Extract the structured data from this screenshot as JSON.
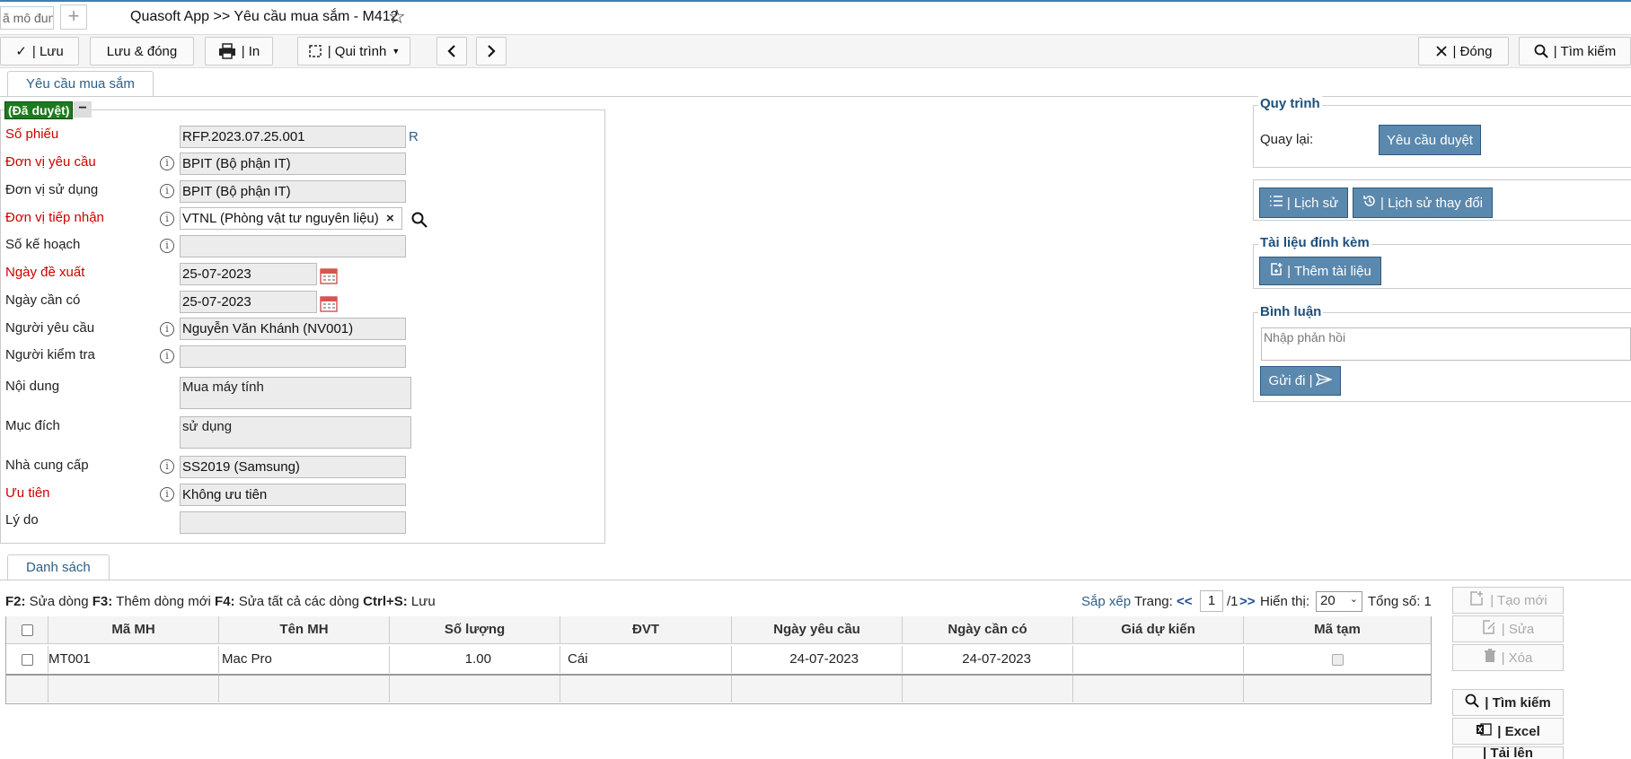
{
  "top": {
    "module_search": "ã mô đun",
    "title": "Quasoft App >> Yêu cầu mua sắm - M412"
  },
  "toolbar": {
    "save": "| Lưu",
    "save_close": "Lưu & đóng",
    "print": "| In",
    "workflow": "| Qui trình",
    "close": "| Đóng",
    "search": "| Tìm kiếm"
  },
  "tabs": {
    "form_tab": "Yêu cầu mua sắm",
    "list_tab": "Danh sách"
  },
  "form": {
    "status": "(Đã duyệt)",
    "collapse": "−",
    "fields": {
      "so_phieu": {
        "label": "Số phiếu",
        "value": "RFP.2023.07.25.001",
        "suffix": "R"
      },
      "don_vi_yeu_cau": {
        "label": "Đơn vị yêu cầu",
        "value": "BPIT (Bộ phận IT)"
      },
      "don_vi_su_dung": {
        "label": "Đơn vị sử dụng",
        "value": "BPIT (Bộ phận IT)"
      },
      "don_vi_tiep_nhan": {
        "label": "Đơn vị tiếp nhận",
        "value": "VTNL (Phòng vật tư nguyên liệu)"
      },
      "so_ke_hoach": {
        "label": "Số kế hoạch",
        "value": ""
      },
      "ngay_de_xuat": {
        "label": "Ngày đề xuất",
        "value": "25-07-2023"
      },
      "ngay_can_co": {
        "label": "Ngày cần có",
        "value": "25-07-2023"
      },
      "nguoi_yeu_cau": {
        "label": "Người yêu cầu",
        "value": "Nguyễn Văn Khánh (NV001)"
      },
      "nguoi_kiem_tra": {
        "label": "Người kiểm tra",
        "value": ""
      },
      "noi_dung": {
        "label": "Nội dung",
        "value": "Mua máy tính"
      },
      "muc_dich": {
        "label": "Mục đích",
        "value": "sử dụng"
      },
      "nha_cung_cap": {
        "label": "Nhà cung cấp",
        "value": "SS2019 (Samsung)"
      },
      "uu_tien": {
        "label": "Ưu tiên",
        "value": "Không ưu tiên"
      },
      "ly_do": {
        "label": "Lý do",
        "value": ""
      }
    }
  },
  "right": {
    "workflow_title": "Quy trình",
    "back_label": "Quay lại:",
    "request_approval": "Yêu cầu duyệt",
    "history": "| Lịch sử",
    "change_history": "| Lịch sử thay đổi",
    "attachments_title": "Tài liệu đính kèm",
    "add_document": "| Thêm tài liệu",
    "comment_title": "Bình luận",
    "comment_placeholder": "Nhập phản hồi",
    "send": "Gửi đi |"
  },
  "list": {
    "hint_f2": "F2:",
    "hint_f2_text": " Sửa dòng ",
    "hint_f3": "F3:",
    "hint_f3_text": " Thêm dòng mới ",
    "hint_f4": "F4:",
    "hint_f4_text": " Sửa tất cả các dòng ",
    "hint_ctrl": "Ctrl+S:",
    "hint_ctrl_text": " Lưu",
    "sort": "Sắp xếp",
    "page_label": "Trang:",
    "first": "<<",
    "page": "1",
    "page_total": "/1",
    "next": ">>",
    "show_label": "Hiển thị:",
    "page_size": "20",
    "total_label": "Tổng số: 1",
    "columns": [
      "Mã MH",
      "Tên MH",
      "Số lượng",
      "ĐVT",
      "Ngày yêu cầu",
      "Ngày cần có",
      "Giá dự kiến",
      "Mã tạm"
    ],
    "rows": [
      {
        "ma_mh": "MT001",
        "ten_mh": "Mac Pro",
        "so_luong": "1.00",
        "dvt": "Cái",
        "ngay_yeu_cau": "24-07-2023",
        "ngay_can_co": "24-07-2023",
        "gia_du_kien": ""
      }
    ],
    "side": {
      "new": "| Tạo mới",
      "edit": "| Sửa",
      "delete": "| Xóa",
      "search": "| Tìm kiếm",
      "excel": "| Excel",
      "more": "| Tải lên"
    }
  }
}
